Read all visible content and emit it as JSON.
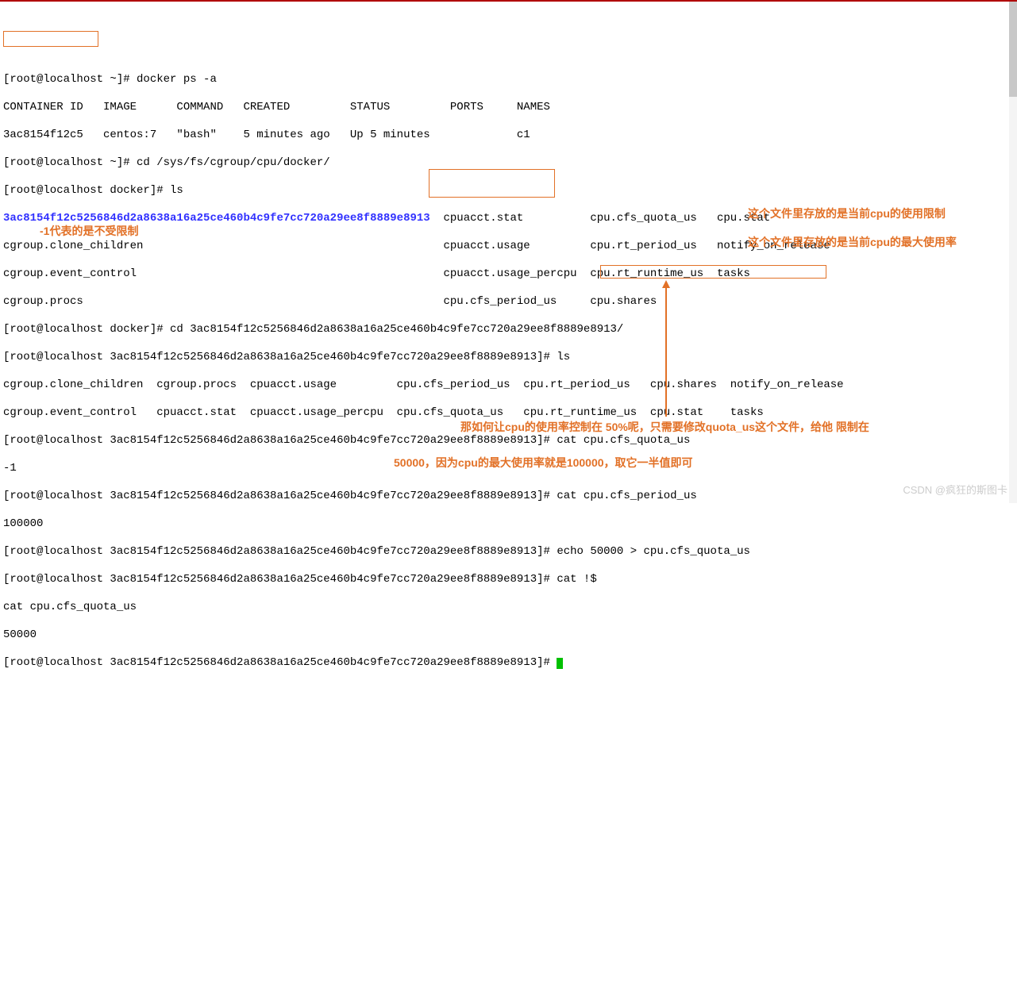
{
  "term": {
    "l1": "[root@localhost ~]# docker ps -a",
    "l2": "CONTAINER ID   IMAGE      COMMAND   CREATED         STATUS         PORTS     NAMES",
    "l3": "3ac8154f12c5   centos:7   \"bash\"    5 minutes ago   Up 5 minutes             c1",
    "l4": "[root@localhost ~]# cd /sys/fs/cgroup/cpu/docker/",
    "l5": "[root@localhost docker]# ls",
    "l6a": "3ac8154f12c5256846d2a8638a16a25ce460b4c9fe7cc720a29ee8f8889e8913",
    "l6b": "  cpuacct.stat          cpu.cfs_quota_us   cpu.stat",
    "l7": "cgroup.clone_children                                             cpuacct.usage         cpu.rt_period_us   notify_on_release",
    "l8": "cgroup.event_control                                              cpuacct.usage_percpu  cpu.rt_runtime_us  tasks",
    "l9": "cgroup.procs                                                      cpu.cfs_period_us     cpu.shares",
    "l10": "[root@localhost docker]# cd 3ac8154f12c5256846d2a8638a16a25ce460b4c9fe7cc720a29ee8f8889e8913/",
    "l11": "[root@localhost 3ac8154f12c5256846d2a8638a16a25ce460b4c9fe7cc720a29ee8f8889e8913]# ls",
    "l12": "cgroup.clone_children  cgroup.procs  cpuacct.usage         cpu.cfs_period_us  cpu.rt_period_us   cpu.shares  notify_on_release",
    "l13": "cgroup.event_control   cpuacct.stat  cpuacct.usage_percpu  cpu.cfs_quota_us   cpu.rt_runtime_us  cpu.stat    tasks",
    "l14": "[root@localhost 3ac8154f12c5256846d2a8638a16a25ce460b4c9fe7cc720a29ee8f8889e8913]# cat cpu.cfs_quota_us",
    "l15": "-1",
    "l16": "[root@localhost 3ac8154f12c5256846d2a8638a16a25ce460b4c9fe7cc720a29ee8f8889e8913]# cat cpu.cfs_period_us",
    "l17": "100000",
    "l18": "[root@localhost 3ac8154f12c5256846d2a8638a16a25ce460b4c9fe7cc720a29ee8f8889e8913]# echo 50000 > cpu.cfs_quota_us",
    "l19": "[root@localhost 3ac8154f12c5256846d2a8638a16a25ce460b4c9fe7cc720a29ee8f8889e8913]# cat !$",
    "l20": "cat cpu.cfs_quota_us",
    "l21": "50000",
    "l22": "[root@localhost 3ac8154f12c5256846d2a8638a16a25ce460b4c9fe7cc720a29ee8f8889e8913]# "
  },
  "annot": {
    "a1": "-1代表的是不受限制",
    "a2": "这个文件里存放的是当前cpu的使用限制",
    "a3": "这个文件里存放的是当前cpu的最大使用率",
    "a4": "那如何让cpu的使用率控制在 50%呢，只需要修改quota_us这个文件，给他  限制在",
    "a5": "50000，因为cpu的最大使用率就是100000，取它一半值即可"
  },
  "watermark": "CSDN @疯狂的斯图卡"
}
